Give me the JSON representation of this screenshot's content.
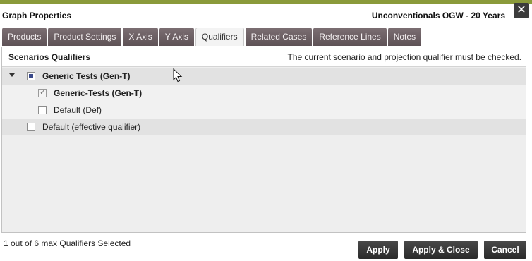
{
  "window": {
    "title": "Graph Properties",
    "subtitle": "Unconventionals OGW - 20 Years",
    "close_glyph": "✕"
  },
  "tabs": [
    {
      "label": "Products",
      "active": false
    },
    {
      "label": "Product Settings",
      "active": false
    },
    {
      "label": "X Axis",
      "active": false
    },
    {
      "label": "Y Axis",
      "active": false
    },
    {
      "label": "Qualifiers",
      "active": true
    },
    {
      "label": "Related Cases",
      "active": false
    },
    {
      "label": "Reference Lines",
      "active": false
    },
    {
      "label": "Notes",
      "active": false
    }
  ],
  "panel": {
    "title": "Scenarios Qualifiers",
    "note": "The current scenario and projection qualifier must be checked.",
    "rows": [
      {
        "label": "Generic Tests (Gen-T)",
        "state": "partial",
        "expanded": true
      },
      {
        "label": "Generic-Tests (Gen-T)",
        "state": "checked"
      },
      {
        "label": "Default (Def)",
        "state": "unchecked"
      },
      {
        "label": "Default (effective qualifier)",
        "state": "unchecked"
      }
    ]
  },
  "footer": {
    "status": "1 out of 6 max Qualifiers Selected",
    "apply": "Apply",
    "apply_close": "Apply & Close",
    "cancel": "Cancel"
  },
  "colors": {
    "accent_bar": "#8a9a3a",
    "tab_bg": "#6f6266",
    "button_bg": "#333333"
  }
}
